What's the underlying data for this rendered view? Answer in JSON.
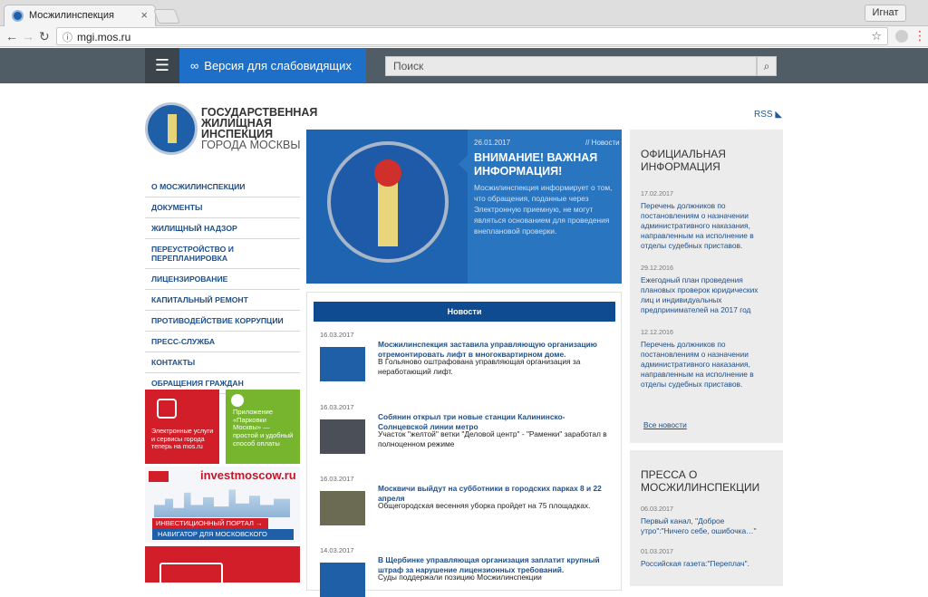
{
  "browser": {
    "tab_title": "Мосжилинспекция",
    "tab_close": "×",
    "user": "Игнат",
    "url": "mgi.mos.ru",
    "back": "←",
    "forward": "→",
    "reload": "↻",
    "info_icon": "ⓘ",
    "star": "☆",
    "menu": "⋮"
  },
  "header": {
    "hamburger": "☰",
    "accessibility_label": "Версия для слабовидящих",
    "glasses": "∞",
    "search_placeholder": "Поиск",
    "search_icon": "⌕"
  },
  "logo": {
    "line1": "ГОСУДАРСТВЕННАЯ",
    "line2": "ЖИЛИЩНАЯ",
    "line3": "ИНСПЕКЦИЯ",
    "line4": "ГОРОДА МОСКВЫ"
  },
  "rss": "RSS ◣",
  "nav": [
    "О МОСЖИЛИНСПЕКЦИИ",
    "ДОКУМЕНТЫ",
    "ЖИЛИЩНЫЙ НАДЗОР",
    "ПЕРЕУСТРОЙСТВО И ПЕРЕПЛАНИРОВКА",
    "ЛИЦЕНЗИРОВАНИЕ",
    "КАПИТАЛЬНЫЙ РЕМОНТ",
    "ПРОТИВОДЕЙСТВИЕ КОРРУПЦИИ",
    "ПРЕСС-СЛУЖБА",
    "КОНТАКТЫ",
    "ОБРАЩЕНИЯ ГРАЖДАН"
  ],
  "promos": {
    "red_text": "Электронные услуги и сервисы города теперь на mos.ru",
    "green_text": "Приложение «Парковки Москвы» — простой и удобный способ оплаты",
    "invest_title": "investmoscow.ru",
    "invest_band1": "ИНВЕСТИЦИОННЫЙ ПОРТАЛ →",
    "invest_band2": "НАВИГАТОР ДЛЯ МОСКОВСКОГО БИЗНЕСА"
  },
  "hero": {
    "date": "26.01.2017",
    "category": "// Новости",
    "title": "ВНИМАНИЕ! ВАЖНАЯ ИНФОРМАЦИЯ!",
    "text": "Мосжилинспекция информирует о том, что обращения, поданные через Электронную приемную, не могут являться основанием для проведения внеплановой проверки."
  },
  "news": {
    "header": "Новости",
    "items": [
      {
        "date": "16.03.2017",
        "headline": "Мосжилинспекция заставила управляющую организацию отремонтировать лифт в многоквартирном доме.",
        "summary": "В Гольяново оштрафована управляющая организация за неработающий лифт."
      },
      {
        "date": "16.03.2017",
        "headline": "Собянин открыл три новые станции Калининско-Солнцевской линии метро",
        "summary": "Участок \"желтой\" ветки \"Деловой центр\" - \"Раменки\" заработал в полноценном режиме"
      },
      {
        "date": "16.03.2017",
        "headline": "Москвичи выйдут на субботники в городских парках 8 и 22 апреля",
        "summary": "Общегородская весенняя уборка пройдет на 75 площадках."
      },
      {
        "date": "14.03.2017",
        "headline": "В Щербинке управляющая организация заплатит крупный штраф за нарушение лицензионных требований.",
        "summary": "Суды поддержали позицию Мосжилинспекции"
      }
    ]
  },
  "official": {
    "title": "ОФИЦИАЛЬНАЯ ИНФОРМАЦИЯ",
    "items": [
      {
        "date": "17.02.2017",
        "text": "Перечень должников по постановлениям о назначении административного наказания, направленным на исполнение в отделы судебных приставов."
      },
      {
        "date": "29.12.2016",
        "text": "Ежегодный план проведения плановых проверок юридических лиц и индивидуальных предпринимателей на 2017 год"
      },
      {
        "date": "12.12.2016",
        "text": "Перечень должников по постановлениям о назначении административного наказания, направленным на исполнение в отделы судебных приставов."
      }
    ],
    "all_news": "Все новости"
  },
  "press": {
    "title": "ПРЕССА О МОСЖИЛИНСПЕКЦИИ",
    "items": [
      {
        "date": "06.03.2017",
        "text": "Первый канал, \"Доброе утро\":\"Ничего себе, ошибочка…\""
      },
      {
        "date": "01.03.2017",
        "text": "Российская газета:\"Переплач\"."
      }
    ]
  }
}
